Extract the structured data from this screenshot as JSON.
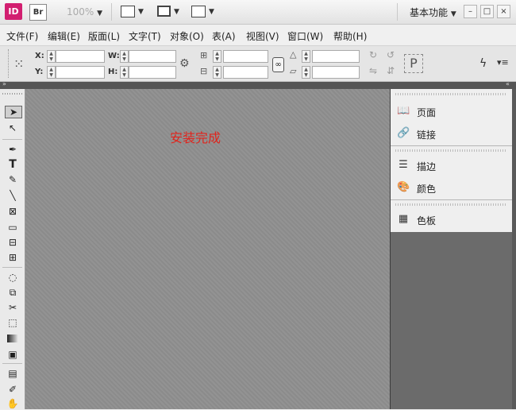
{
  "titlebar": {
    "app_logo": "ID",
    "bridge_logo": "Br",
    "zoom": "100%",
    "workspace": "基本功能",
    "workspace_caret": "▼",
    "min_symbol": "–",
    "restore_symbol": "□",
    "close_symbol": "×"
  },
  "menubar": {
    "items": [
      "文件(F)",
      "编辑(E)",
      "版面(L)",
      "文字(T)",
      "对象(O)",
      "表(A)",
      "视图(V)",
      "窗口(W)",
      "帮助(H)"
    ]
  },
  "control": {
    "x_label": "X:",
    "y_label": "Y:",
    "w_label": "W:",
    "h_label": "H:",
    "x_value": "",
    "y_value": "",
    "w_value": "",
    "h_value": ""
  },
  "canvas": {
    "message": "安装完成"
  },
  "panels": {
    "items": [
      {
        "label": "页面",
        "icon": "pages-icon"
      },
      {
        "label": "链接",
        "icon": "links-icon"
      },
      {
        "label": "描边",
        "icon": "stroke-icon"
      },
      {
        "label": "颜色",
        "icon": "color-icon"
      },
      {
        "label": "色板",
        "icon": "swatches-icon"
      }
    ]
  },
  "colors": {
    "accent": "#d21f70",
    "message": "#e0241c",
    "canvas": "#8e8e8e"
  }
}
